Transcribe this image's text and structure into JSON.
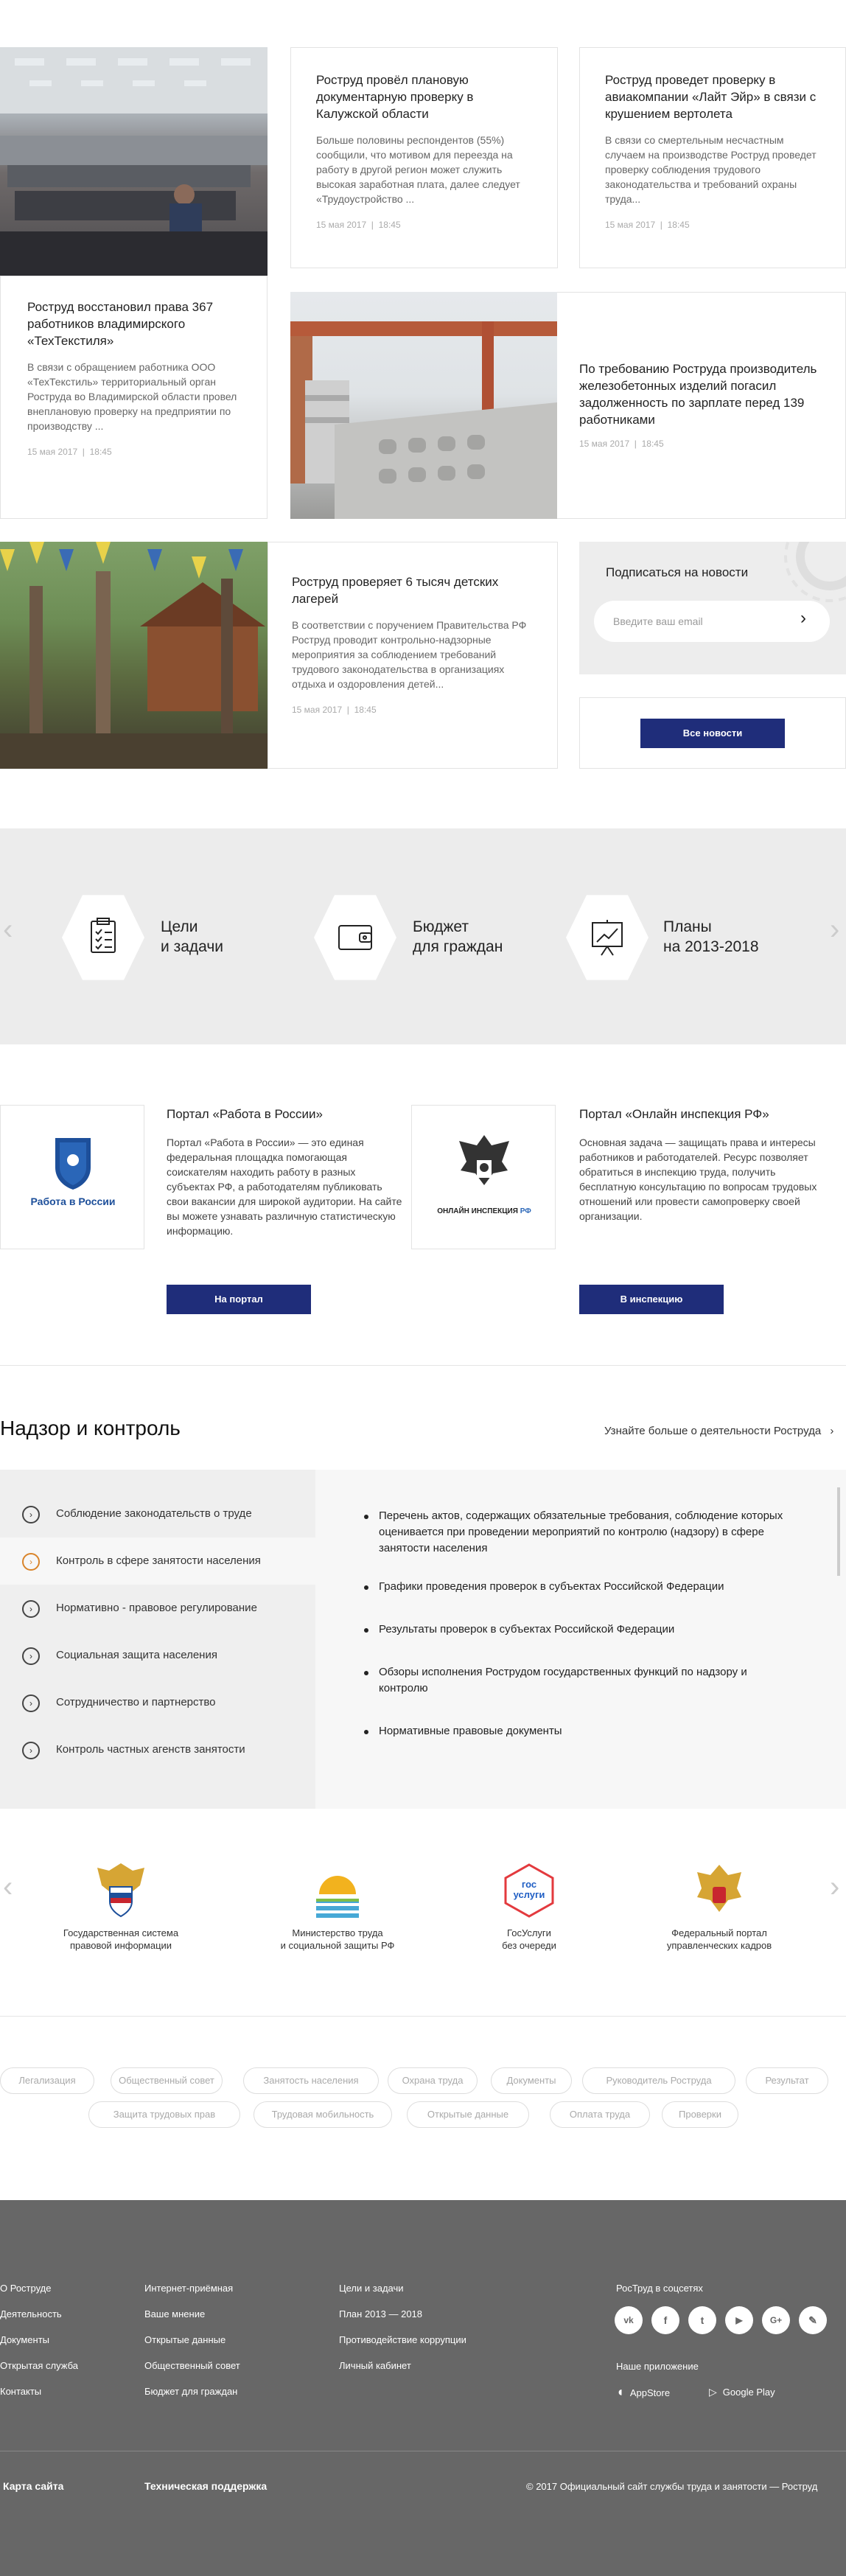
{
  "news": [
    {
      "title": "Роструд провёл плановую документарную проверку в Калужской области",
      "excerpt": "Больше половины респондентов (55%) сообщили, что мотивом для переезда на работу в другой регион может служить высокая заработная плата, далее следует «Трудоустройство ...",
      "date": "15 мая 2017",
      "time": "18:45"
    },
    {
      "title": "Роструд проведет проверку в авиакомпании «Лайт Эйр» в связи с крушением вертолета",
      "excerpt": "В связи со смертельным несчастным случаем на производстве Роструд проведет проверку соблюдения трудового законодательства и требований охраны труда...",
      "date": "15 мая 2017",
      "time": "18:45"
    },
    {
      "title": "Роструд восстановил права 367 работников владимирского «ТехТекстиля»",
      "excerpt": "В связи с обращением работника ООО «ТехТекстиль» территориальный орган Роструда во Владимирской области провел внеплановую проверку на предприятии по производству ...",
      "date": "15 мая 2017",
      "time": "18:45"
    },
    {
      "title": "По требованию Роструда производитель железобетонных изделий погасил задолженность по зарплате перед 139 работниками",
      "excerpt": "",
      "date": "15 мая 2017",
      "time": "18:45"
    },
    {
      "title": "Роструд проверяет 6 тысяч детских лагерей",
      "excerpt": "В соответствии с поручением Правительства РФ Роструд проводит контрольно-надзорные мероприятия за соблюдением требований трудового законодательства в организациях отдыха и оздоровления детей...",
      "date": "15 мая 2017",
      "time": "18:45"
    }
  ],
  "subscribe": {
    "title": "Подписаться на новости",
    "placeholder": "Введите ваш email"
  },
  "all_news_label": "Все новости",
  "band": [
    {
      "label1": "Цели",
      "label2": "и задачи",
      "icon": "checklist-icon"
    },
    {
      "label1": "Бюджет",
      "label2": "для граждан",
      "icon": "wallet-icon"
    },
    {
      "label1": "Планы",
      "label2": "на 2013-2018",
      "icon": "presentation-chart-icon"
    }
  ],
  "portals": [
    {
      "title": "Портал «Работа в России»",
      "text": "Портал «Работа в России» — это единая федеральная площадка помогающая соискателям находить работу в разных субъектах РФ, а работодателям публиковать свои вакансии для широкой аудитории. На сайте вы можете узнавать различную статистическую информацию.",
      "button": "На портал",
      "logo_text": "Работа в России"
    },
    {
      "title": "Портал «Онлайн инспекция РФ»",
      "text": "Основная задача — защищать права и интересы работников и работодателей. Ресурс позволяет обратиться в инспекцию труда, получить бесплатную консультацию по вопросам трудовых отношений или провести самопроверку своей организации.",
      "button": "В инспекцию",
      "logo_text": "ОНЛАЙН ИНСПЕКЦИЯ",
      "logo_suffix": "РФ"
    }
  ],
  "supervision": {
    "title": "Надзор и контроль",
    "more_link": "Узнайте больше о деятельности Роструда",
    "nav": [
      "Соблюдение законодательств о труде",
      "Контроль в сфере занятости населения",
      "Нормативно - правовое регулирование",
      "Социальная защита населения",
      "Сотрудничество и партнерство",
      "Контроль частных агенств занятости"
    ],
    "active_index": 1,
    "items": [
      "Перечень актов, содержащих обязательные требования, соблюдение которых оценивается при проведении мероприятий по контролю (надзору) в сфере занятости населения",
      "Графики проведения проверок в субъектах Российской Федерации",
      "Результаты проверок в субъектах Российской Федерации",
      "Обзоры исполнения Рострудом государственных функций по надзору и контролю",
      "Нормативные правовые документы"
    ]
  },
  "partners": [
    {
      "line1": "Государственная система",
      "line2": "правовой информации"
    },
    {
      "line1": "Министерство труда",
      "line2": "и социальной защиты РФ"
    },
    {
      "line1": "ГосУслуги",
      "line2": "без очереди",
      "logo1": "гос",
      "logo2": "услуги"
    },
    {
      "line1": "Федеральный портал",
      "line2": "управленческих кадров"
    }
  ],
  "tags_row1": [
    "Легализация",
    "Общественный совет",
    "Занятость населения",
    "Охрана труда",
    "Документы",
    "Руководитель Роструда",
    "Результат"
  ],
  "tags_row2": [
    "Защита трудовых прав",
    "Трудовая мобильность",
    "Открытые данные",
    "Оплата труда",
    "Проверки"
  ],
  "footer": {
    "col1": [
      "О Роструде",
      "Деятельность",
      "Документы",
      "Открытая служба",
      "Контакты"
    ],
    "col2": [
      "Интернет-приёмная",
      "Ваше мнение",
      "Открытые данные",
      "Общественный совет",
      "Бюджет для граждан"
    ],
    "col3": [
      "Цели и задачи",
      "План 2013 — 2018",
      "Противодействие коррупции",
      "Личный кабинет"
    ],
    "social_title": "РосТруд в соцсетях",
    "social": [
      "vk",
      "f",
      "t",
      "▶",
      "G+",
      "✎"
    ],
    "app_title": "Наше приложение",
    "appstore": "AppStore",
    "googleplay": "Google Play",
    "sitemap": "Карта сайта",
    "support": "Техническая поддержка",
    "copyright": "© 2017 Официальный сайт службы труда и занятости — Роструд"
  }
}
